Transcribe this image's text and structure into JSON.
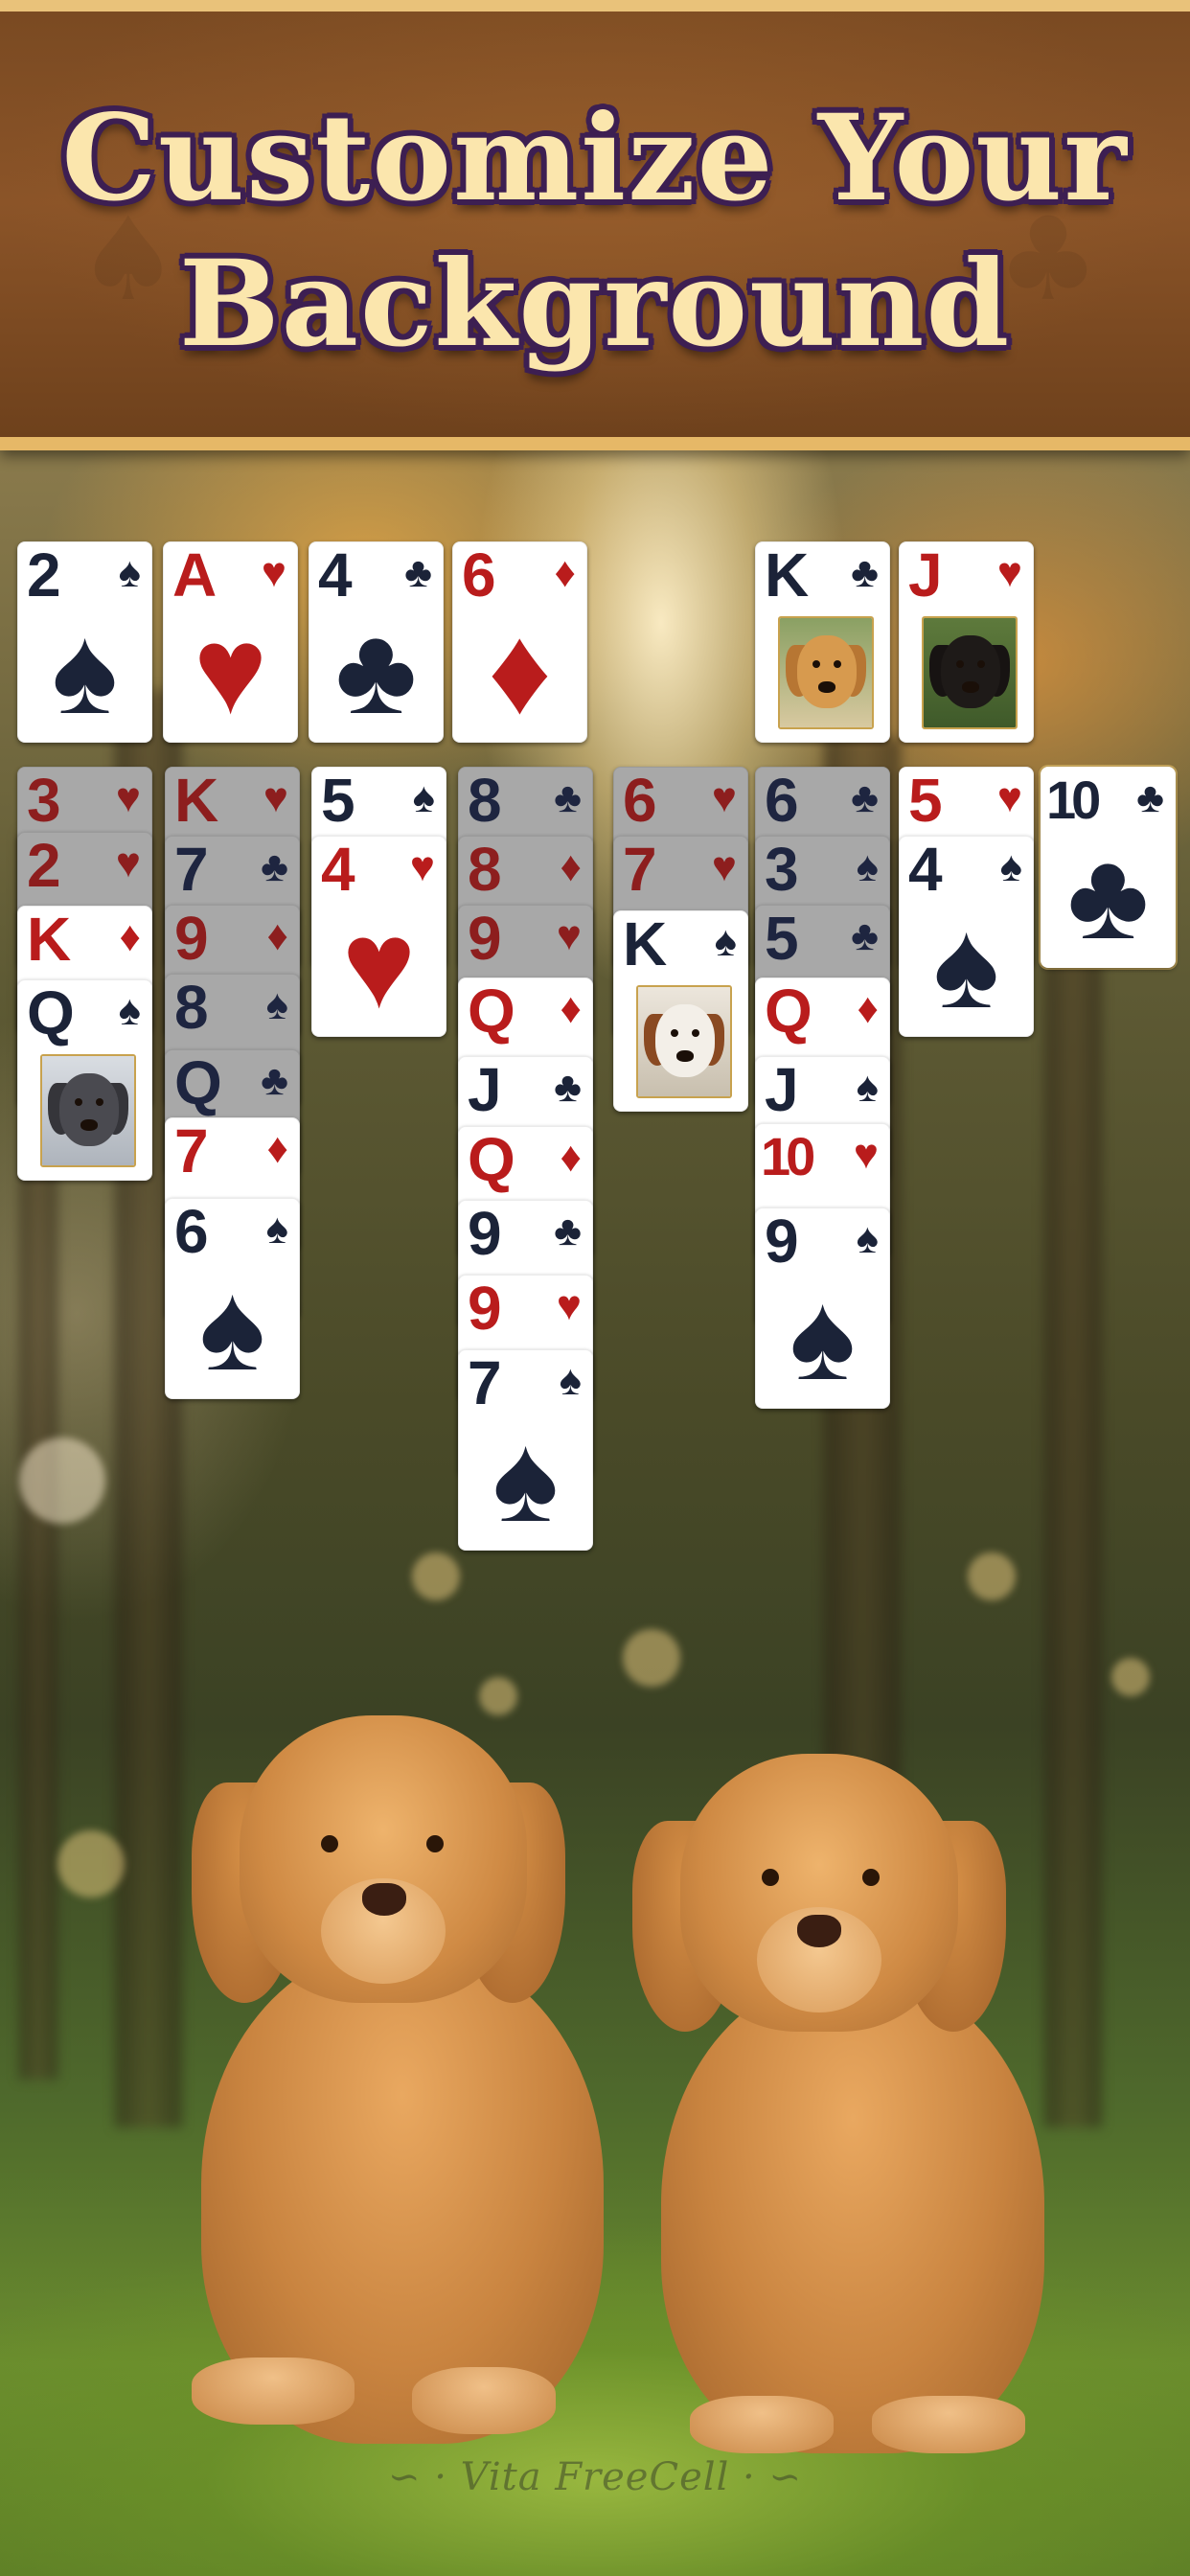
{
  "header": {
    "title_line1": "Customize Your",
    "title_line2": "Background"
  },
  "watermark": {
    "text": "Vita FreeCell"
  },
  "colors": {
    "red_suit": "#b91c1c",
    "black_suit": "#1b2338",
    "banner_brown": "#7a4a22",
    "title_fill": "#fbe6ad",
    "title_outline": "#3d1f52"
  },
  "foundations": [
    {
      "rank": "2",
      "suit": "♠",
      "color": "black"
    },
    {
      "rank": "A",
      "suit": "♥",
      "color": "red"
    },
    {
      "rank": "4",
      "suit": "♣",
      "color": "black"
    },
    {
      "rank": "6",
      "suit": "♦",
      "color": "red"
    }
  ],
  "free_cells": [
    {
      "rank": "K",
      "suit": "♣",
      "color": "black",
      "face": "golden-retriever"
    },
    {
      "rank": "J",
      "suit": "♥",
      "color": "red",
      "face": "black-doberman"
    }
  ],
  "tableau": [
    [
      {
        "rank": "3",
        "suit": "♥",
        "color": "red"
      },
      {
        "rank": "2",
        "suit": "♥",
        "color": "red"
      },
      {
        "rank": "K",
        "suit": "♦",
        "color": "red"
      },
      {
        "rank": "Q",
        "suit": "♠",
        "color": "black",
        "face": "french-bulldog"
      }
    ],
    [
      {
        "rank": "K",
        "suit": "♥",
        "color": "red"
      },
      {
        "rank": "7",
        "suit": "♣",
        "color": "black"
      },
      {
        "rank": "9",
        "suit": "♦",
        "color": "red"
      },
      {
        "rank": "8",
        "suit": "♠",
        "color": "black"
      },
      {
        "rank": "Q",
        "suit": "♣",
        "color": "black"
      },
      {
        "rank": "7",
        "suit": "♦",
        "color": "red"
      },
      {
        "rank": "6",
        "suit": "♠",
        "color": "black"
      }
    ],
    [
      {
        "rank": "5",
        "suit": "♠",
        "color": "black"
      },
      {
        "rank": "4",
        "suit": "♥",
        "color": "red"
      }
    ],
    [
      {
        "rank": "8",
        "suit": "♣",
        "color": "black"
      },
      {
        "rank": "8",
        "suit": "♦",
        "color": "red"
      },
      {
        "rank": "9",
        "suit": "♥",
        "color": "red"
      },
      {
        "rank": "Q",
        "suit": "♦",
        "color": "red"
      },
      {
        "rank": "J",
        "suit": "♣",
        "color": "black"
      },
      {
        "rank": "Q",
        "suit": "♦",
        "color": "red"
      },
      {
        "rank": "9",
        "suit": "♣",
        "color": "black"
      },
      {
        "rank": "9",
        "suit": "♥",
        "color": "red"
      },
      {
        "rank": "7",
        "suit": "♠",
        "color": "black"
      }
    ],
    [
      {
        "rank": "6",
        "suit": "♥",
        "color": "red"
      },
      {
        "rank": "7",
        "suit": "♥",
        "color": "red"
      },
      {
        "rank": "K",
        "suit": "♠",
        "color": "black",
        "face": "beagle"
      }
    ],
    [
      {
        "rank": "6",
        "suit": "♣",
        "color": "black"
      },
      {
        "rank": "3",
        "suit": "♠",
        "color": "black"
      },
      {
        "rank": "5",
        "suit": "♣",
        "color": "black"
      },
      {
        "rank": "Q",
        "suit": "♦",
        "color": "red"
      },
      {
        "rank": "J",
        "suit": "♠",
        "color": "black"
      },
      {
        "rank": "10",
        "suit": "♥",
        "color": "red"
      },
      {
        "rank": "9",
        "suit": "♠",
        "color": "black"
      }
    ],
    [
      {
        "rank": "5",
        "suit": "♥",
        "color": "red"
      },
      {
        "rank": "4",
        "suit": "♠",
        "color": "black"
      }
    ],
    [
      {
        "rank": "10",
        "suit": "♣",
        "color": "black"
      }
    ]
  ]
}
